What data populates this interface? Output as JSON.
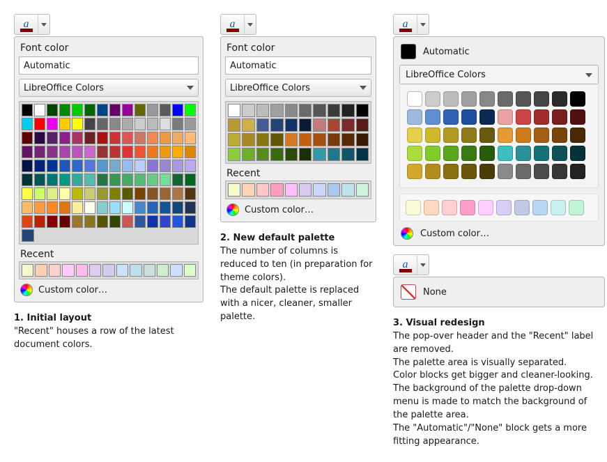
{
  "popover_title": "Font color",
  "automatic_label": "Automatic",
  "palette_select_label": "LibreOffice Colors",
  "recent_label": "Recent",
  "custom_label": "Custom color…",
  "none_label": "None",
  "palette1_rows": [
    [
      "#000000",
      "#ffffff",
      "#004400",
      "#008800",
      "#00cc00",
      "#006600",
      "#004488",
      "#660066",
      "#990099",
      "#666600",
      "#999999",
      "#5a5a5a",
      "#0000ff",
      "#00ff00"
    ],
    [
      "#00ccee",
      "#ff0000",
      "#ee00ee",
      "#ffcc00",
      "#ffff00",
      "#444444",
      "#666666",
      "#888888",
      "#aaaaaa",
      "#cccccc",
      "#bbbbbb",
      "#dddddd",
      "#7a7a7a",
      "#9a9a9a"
    ],
    [
      "#5a0000",
      "#2a0944",
      "#552266",
      "#882288",
      "#aa3366",
      "#6a2222",
      "#aa1111",
      "#cc3333",
      "#dd5555",
      "#cc7766",
      "#ee8855",
      "#ee9944",
      "#eeaa66",
      "#ffbb77"
    ],
    [
      "#661166",
      "#772277",
      "#883388",
      "#aa44aa",
      "#bb55bb",
      "#cc66cc",
      "#993333",
      "#bb3333",
      "#dd3333",
      "#ee5533",
      "#ee7722",
      "#ee9911",
      "#ffaa00",
      "#dd8800"
    ],
    [
      "#001144",
      "#002277",
      "#003399",
      "#2255bb",
      "#3366cc",
      "#5577dd",
      "#5599cc",
      "#77aacc",
      "#99bbee",
      "#bbccff",
      "#8877cc",
      "#9988cc",
      "#aa99dd",
      "#bbaaee"
    ],
    [
      "#003333",
      "#005555",
      "#007777",
      "#009988",
      "#33aa99",
      "#55bbaa",
      "#227744",
      "#339955",
      "#44aa66",
      "#55bb77",
      "#66cc88",
      "#77dd99",
      "#116633",
      "#006622"
    ],
    [
      "#ffff44",
      "#ccff66",
      "#ddee88",
      "#ffffaa",
      "#bbbb00",
      "#cccc77",
      "#999933",
      "#808000",
      "#5a5a00",
      "#774400",
      "#885522",
      "#996633",
      "#aa7744",
      "#553311"
    ],
    [
      "#ffbb66",
      "#ff9944",
      "#ff8822",
      "#dd7711",
      "#ffee99",
      "#ffffee",
      "#88cccc",
      "#99ddff",
      "#ccffff",
      "#4488cc",
      "#2266bb",
      "#115599",
      "#114477",
      "#223355"
    ],
    [
      "#dd4411",
      "#bb2200",
      "#880000",
      "#660000",
      "#997733",
      "#887722",
      "#555500",
      "#334400",
      "#cc5555",
      "#335599",
      "#1133aa",
      "#3344cc",
      "#2255dd",
      "#113388"
    ],
    [
      "#224477"
    ]
  ],
  "recent1": [
    "#f7f7cc",
    "#ffd0b0",
    "#ffd0d0",
    "#ffccff",
    "#ffbbee",
    "#e0ccee",
    "#d0ccee",
    "#cce0ff",
    "#bbe0ee",
    "#cce0dd",
    "#ccf0cc",
    "#cce0ff",
    "#ddffcc"
  ],
  "palette2_rows": [
    [
      "#ffffff",
      "#cccccc",
      "#bcbcbc",
      "#a0a0a0",
      "#888888",
      "#6a6a6a",
      "#555555",
      "#3a3a3a",
      "#222222",
      "#000000"
    ],
    [
      "#bb9933",
      "#d1b04a",
      "#445a99",
      "#224477",
      "#113366",
      "#0a1a33",
      "#c47a7a",
      "#aa4433",
      "#7a2a2a",
      "#5a1a1a"
    ],
    [
      "#bbaa33",
      "#a98a22",
      "#887711",
      "#665500",
      "#d87722",
      "#c45e11",
      "#a35011",
      "#7a3a0a",
      "#5a2a05",
      "#3a1a00"
    ],
    [
      "#8ecc3c",
      "#6fae28",
      "#568c1c",
      "#3b6a0e",
      "#2a4a08",
      "#1a3004",
      "#3299aa",
      "#227788",
      "#115566",
      "#003344"
    ]
  ],
  "recent2": [
    "#f7f7cc",
    "#ffd3b5",
    "#ffc8c8",
    "#ff9ec0",
    "#ffbfff",
    "#d9c8f2",
    "#c8d8ff",
    "#a8caf0",
    "#c0e2ea",
    "#ccf5e0"
  ],
  "palette3_rows": [
    [
      "#ffffff",
      "#cccccc",
      "#bcbcbc",
      "#a0a0a0",
      "#888888",
      "#6a6a6a",
      "#555555",
      "#444444",
      "#2a2a2a",
      "#000000"
    ],
    [
      "#9db9e0",
      "#5f8fd1",
      "#2f62b3",
      "#1e4f9e",
      "#0a2a55",
      "#eaa2a2",
      "#cc4444",
      "#a02c2c",
      "#7a1e1e",
      "#501010"
    ],
    [
      "#e6cf4a",
      "#cfb82a",
      "#b39a22",
      "#8f7a18",
      "#6a5a10",
      "#e69a33",
      "#cc7a1a",
      "#a35f11",
      "#7a4409",
      "#4a2a04"
    ],
    [
      "#aadd3c",
      "#7fcc2a",
      "#5aa61c",
      "#3a7a12",
      "#2a5a0c",
      "#3fbec2",
      "#2a9099",
      "#167078",
      "#0c5058",
      "#043038"
    ],
    [
      "#d4a92a",
      "#b38d1a",
      "#8a6f12",
      "#6b560d",
      "#4a3c07",
      "#8a8a8a",
      "#6a6a6a",
      "#4a4a4a",
      "#363636",
      "#222222"
    ]
  ],
  "recent3": [
    "#fbfbd8",
    "#ffd9bf",
    "#ffcfcf",
    "#ff9ec8",
    "#ffcfff",
    "#d9ccf5",
    "#c2c8e6",
    "#b6d8f5",
    "#c8f0ee",
    "#c2f5d8"
  ],
  "captions": {
    "c1": {
      "title": "1. Initial layout",
      "body": "\"Recent\" houses a row of the latest document colors."
    },
    "c2": {
      "title": "2. New default palette",
      "body": "The number of columns is reduced to ten (in preparation for theme colors).\nThe default palette is replaced with a nicer, cleaner, smaller palette."
    },
    "c3": {
      "title": "3. Visual redesign",
      "body": "The pop-over header and the \"Recent\" label are removed.\nThe palette area is visually separated.\nColor blocks get bigger and cleaner-looking.\nThe background of the palette drop-down menu is made to match the background of the palette area.\nThe \"Automatic\"/\"None\" block gets a more fitting appearance."
    }
  }
}
